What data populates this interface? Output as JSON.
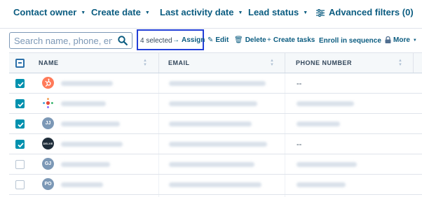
{
  "filters": {
    "contact_owner": "Contact owner",
    "create_date": "Create date",
    "last_activity_date": "Last activity date",
    "lead_status": "Lead status",
    "advanced": "Advanced filters (0)"
  },
  "search": {
    "placeholder": "Search name, phone, email"
  },
  "bulk_actions": {
    "selected": "4 selected",
    "assign": "Assign",
    "edit": "Edit",
    "delete": "Delete",
    "create_tasks": "Create tasks",
    "enroll": "Enroll in sequence",
    "more": "More"
  },
  "table": {
    "columns": [
      "NAME",
      "EMAIL",
      "PHONE NUMBER"
    ],
    "rows": [
      {
        "checked": true,
        "avatar": {
          "type": "hubspot",
          "color": "#ff7a59"
        },
        "phone": "--"
      },
      {
        "checked": true,
        "avatar": {
          "type": "dots",
          "color": "#ffffff"
        },
        "phone": ""
      },
      {
        "checked": true,
        "avatar": {
          "type": "initials",
          "text": "JJ",
          "color": "#7c98b6"
        },
        "phone": ""
      },
      {
        "checked": true,
        "avatar": {
          "type": "logo",
          "text": "DELVE",
          "color": "#1f2d3a"
        },
        "phone": "--"
      },
      {
        "checked": false,
        "avatar": {
          "type": "initials",
          "text": "GJ",
          "color": "#7c98b6"
        },
        "phone": ""
      },
      {
        "checked": false,
        "avatar": {
          "type": "initials",
          "text": "PO",
          "color": "#7c98b6"
        },
        "phone": ""
      }
    ]
  },
  "colors": {
    "link": "#0b5c80",
    "checkbox": "#0091ae",
    "highlight_box": "#2340d8"
  }
}
